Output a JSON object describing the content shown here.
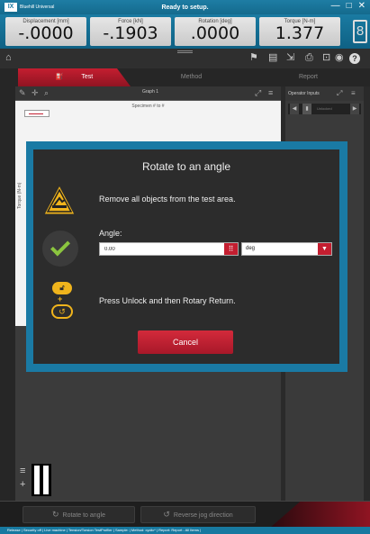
{
  "titlebar": {
    "logo": "IX",
    "app_name": "Bluehill Universal",
    "status": "Ready to setup.",
    "minimize": "—",
    "restore": "□",
    "close": "✕"
  },
  "readouts": [
    {
      "label": "Displacement [mm]",
      "value": "-.0000"
    },
    {
      "label": "Force [kN]",
      "value": "-.1903"
    },
    {
      "label": "Rotation [deg]",
      "value": ".0000"
    },
    {
      "label": "Torque [N-m]",
      "value": "1.377"
    }
  ],
  "tabs": {
    "test": "Test",
    "method": "Method",
    "report": "Report"
  },
  "graph": {
    "title": "Graph 1",
    "specimen": "Specimen # to #",
    "y_axis": "Torque (N-m)"
  },
  "operator_inputs": {
    "title": "Operator Inputs",
    "field_text": "Unlocked"
  },
  "dialog": {
    "title": "Rotate to an angle",
    "message": "Remove all objects from the test area.",
    "angle_label": "Angle:",
    "angle_value": "0.00",
    "unit": "deg",
    "message2": "Press Unlock and then Rotary Return.",
    "cancel": "Cancel"
  },
  "controls": {
    "rotate": "Rotate to angle",
    "reverse": "Reverse jog direction"
  },
  "statusbar": {
    "text": "Release  |  Security off  |  Live machine  |  Tension/Torsion TestProfiler  |  Sample:  |  Method: cyclic*  |  Report: Report - All Items  |"
  },
  "colors": {
    "accent_blue": "#1a7aa4",
    "accent_red": "#c41e30",
    "warning_yellow": "#f0b41c",
    "ok_green": "#8bc53f"
  }
}
